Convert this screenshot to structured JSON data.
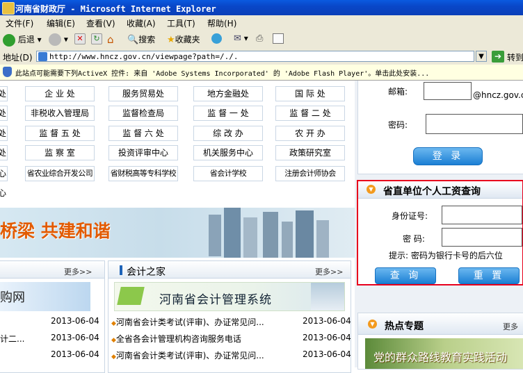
{
  "window": {
    "title": "河南省财政厅 - Microsoft Internet Explorer"
  },
  "menu": [
    "文件(F)",
    "编辑(E)",
    "查看(V)",
    "收藏(A)",
    "工具(T)",
    "帮助(H)"
  ],
  "toolbar": {
    "back": "后退",
    "search": "搜索",
    "favorites": "收藏夹"
  },
  "address": {
    "label": "地址(D)",
    "url": "http://www.hncz.gov.cn/viewpage?path=/./.",
    "go": "转到"
  },
  "infobar": {
    "text": "此站点可能需要下列ActiveX 控件: 来自 'Adobe Systems Incorporated' 的 'Adobe Flash Player'。单击此处安装..."
  },
  "depts": {
    "left_col": [
      "处",
      "处",
      "处",
      "处",
      "心",
      "心"
    ],
    "rows": [
      [
        "企 业 处",
        "服务贸易处",
        "地方金融处",
        "国 际 处"
      ],
      [
        "非税收入管理局",
        "监督检查局",
        "监 督 一 处",
        "监 督 二 处"
      ],
      [
        "监 督 五 处",
        "监 督 六 处",
        "综 改 办",
        "农 开 办"
      ],
      [
        "监 察 室",
        "投资评审中心",
        "机关服务中心",
        "政策研究室"
      ],
      [
        "省农业综合开发公司",
        "省财税高等专科学校",
        "省会计学校",
        "注册会计师协会"
      ]
    ]
  },
  "login": {
    "email_label": "邮箱:",
    "domain": "@hncz.gov.cn",
    "password_label": "密码:",
    "login_button": "登 录"
  },
  "salary": {
    "title": "省直单位个人工资查询",
    "id_label": "身份证号:",
    "pwd_label": "密 码:",
    "hint": "提示: 密码为银行卡号的后六位",
    "query_button": "查 询",
    "reset_button": "重 置"
  },
  "banner": {
    "text": "桥梁 共建和谐"
  },
  "left_panel": {
    "more": "更多>>",
    "image_text": "购网",
    "items": [
      {
        "title": "",
        "date": "2013-06-04"
      },
      {
        "title": "计二...",
        "date": "2013-06-04"
      },
      {
        "title": "",
        "date": "2013-06-04"
      }
    ]
  },
  "accounting": {
    "title": "会计之家",
    "more": "更多>>",
    "system_banner": "河南省会计管理系统",
    "items": [
      {
        "title": "河南省会计类考试(评审)、办证常见问...",
        "date": "2013-06-04"
      },
      {
        "title": "全省各会计管理机构咨询服务电话",
        "date": "2013-06-04"
      },
      {
        "title": "河南省会计类考试(评审)、办证常见问...",
        "date": "2013-06-04"
      }
    ]
  },
  "hot": {
    "title": "热点专题",
    "more": "更多",
    "banner": "党的群众路线教育实践活动"
  }
}
